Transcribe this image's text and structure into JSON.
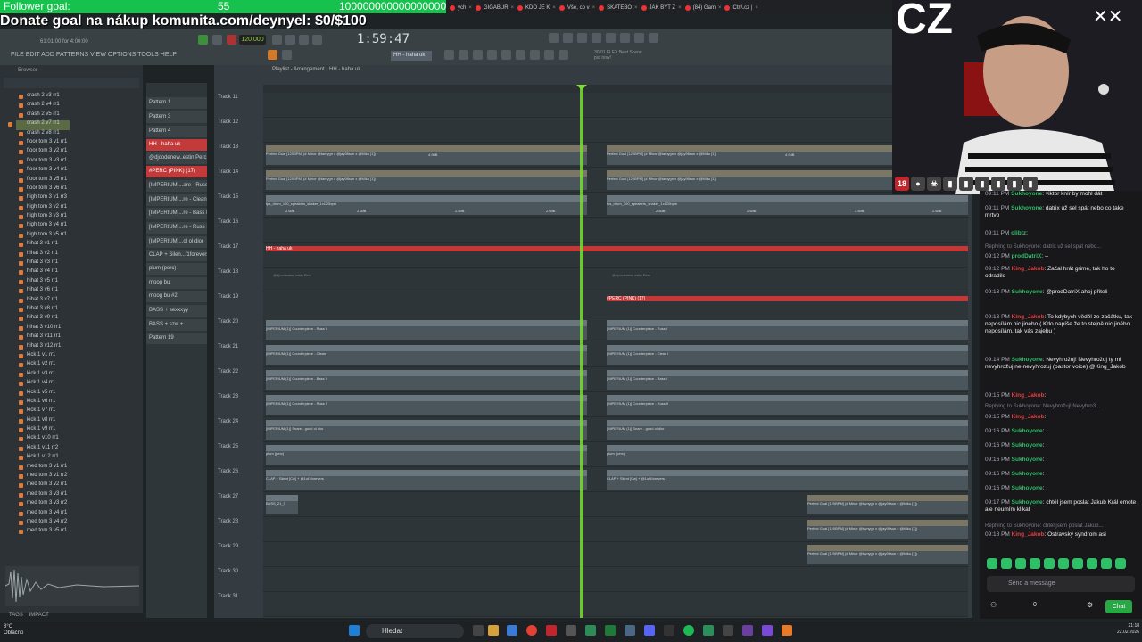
{
  "overlay": {
    "follower_label": "Follower goal:",
    "follower_count": "55",
    "follower_target": "1000000000000000000",
    "donate_text": "Donate goal na nákup komunita.com/deynyel: $0/$100",
    "cz_logo": "CZ"
  },
  "browser_tabs": [
    "ych",
    "GIGABUR",
    "KDO JE K",
    "Vše, co v",
    "SKATEBO",
    "JAK BÝT Z",
    "(84) Gam",
    "Ctrl\\.cz |"
  ],
  "fl": {
    "menu": "FILE EDIT ADD PATTERNS VIEW OPTIONS TOOLS HELP",
    "song_info": "61:01:00 for 4:00:00",
    "bpm": "120.000",
    "time": "1:59:47",
    "pattern_selector": "HH - haha uk",
    "hint_line1": "30:01 FLEX Beat Scene",
    "hint_line2": "put now!",
    "browser_title": "Browser",
    "playlist_title": "Playlist - Arrangement › HH - haha uk",
    "tags_label": "TAGS",
    "impact_label": "IMPACT"
  },
  "browser_items": [
    "crash 2 v3 rr1",
    "crash 2 v4 rr1",
    "crash 2 v5 rr1",
    "crash 2 v7 rr1",
    "crash 2 v8 rr1",
    "floor tom 3 v1 rr1",
    "floor tom 3 v2 rr1",
    "floor tom 3 v3 rr1",
    "floor tom 3 v4 rr1",
    "floor tom 3 v5 rr1",
    "floor tom 3 v6 rr1",
    "high tom 3 v1 rr3",
    "high tom 3 v2 rr1",
    "high tom 3 v3 rr1",
    "high tom 3 v4 rr1",
    "high tom 3 v5 rr1",
    "hihat 3 v1 rr1",
    "hihat 3 v2 rr1",
    "hihat 3 v3 rr1",
    "hihat 3 v4 rr1",
    "hihat 3 v5 rr1",
    "hihat 3 v6 rr1",
    "hihat 3 v7 rr1",
    "hihat 3 v8 rr1",
    "hihat 3 v9 rr1",
    "hihat 3 v10 rr1",
    "hihat 3 v11 rr1",
    "hihat 3 v12 rr1",
    "kick 1 v1 rr1",
    "kick 1 v2 rr1",
    "kick 1 v3 rr1",
    "kick 1 v4 rr1",
    "kick 1 v5 rr1",
    "kick 1 v6 rr1",
    "kick 1 v7 rr1",
    "kick 1 v8 rr1",
    "kick 1 v9 rr1",
    "kick 1 v10 rr1",
    "kick 1 v11 rr2",
    "kick 1 v12 rr1",
    "med tom 3 v1 rr1",
    "med tom 3 v1 rr2",
    "med tom 3 v2 rr1",
    "med tom 3 v3 rr1",
    "med tom 3 v3 rr2",
    "med tom 3 v4 rr1",
    "med tom 3 v4 rr2",
    "med tom 3 v5 rr1"
  ],
  "patterns": [
    "Pattern 1",
    "Pattern 3",
    "Pattern 4",
    "HH - haha uk",
    "@djcodenew..estin Perc",
    "#PERC (PINK) (17)",
    "[IMPERIUM]...are - Russ I",
    "[IMPERIUM]...re - Clean I",
    "[IMPERIUM]...re - Bass I",
    "[IMPERIUM]...re - Russ II",
    "[IMPERIUM]...ol ol dior",
    "CLAP + Silen...f1forevers",
    "plum (perc)",
    "moog bu",
    "moog bu #2",
    "BASS + sexxxyy",
    "BASS + szw +",
    "Pattern 19"
  ],
  "tracks": [
    "Track 11",
    "Track 12",
    "Track 13",
    "Track 14",
    "Track 15",
    "Track 16",
    "Track 17",
    "Track 18",
    "Track 19",
    "Track 20",
    "Track 21",
    "Track 22",
    "Track 23",
    "Track 24",
    "Track 25",
    "Track 26",
    "Track 27",
    "Track 28",
    "Track 29",
    "Track 30",
    "Track 31"
  ],
  "clips": {
    "perfect": "Perfect Goal [120BPM] (# Minor @tamygn x @jay98sun x @Miku [1])",
    "shaker": "fps_drum_100_speakers_shaker_1x120bpm",
    "hh": "HH - haha uk",
    "perc": "#PERC (PINK) (17)",
    "russ": "[IMPERIUM (1)] Counterpiece - Russ I",
    "clean": "[IMPERIUM (1)] Counterpiece - Clean I",
    "bass": "[IMPERIUM (1)] Counterpiece - Bass I",
    "russ2": "[IMPERIUM (1)] Counterpiece - Russ II",
    "snare": "[IMPERIUM (1)] Snare - good ol dior",
    "plum": "plum (perc)",
    "clap": "CLAP + Silent [Cw] + @1of1forevers",
    "bass2": "BASS_21_5",
    "db": "2.6dB",
    "db2": "4.9dB",
    "perc_ghost": "@djcodenew..estin Perc"
  },
  "chat": [
    {
      "time": "09:11 PM",
      "name": "Sukhoyone",
      "color": "g",
      "text": "viktor knír by mohl dát"
    },
    {
      "time": "09:11 PM",
      "name": "Sukhoyone",
      "color": "g",
      "text": "datrix už sel spát nebo co take mrtvo"
    },
    {
      "time": "09:11 PM",
      "name": "olibtz",
      "color": "g",
      "text": ""
    },
    {
      "time": "",
      "name": "",
      "color": "",
      "reply": "Replying to Sukhoyone: datrix už sel spát nebo..."
    },
    {
      "time": "09:12 PM",
      "name": "prodDatriX",
      "color": "g",
      "text": "--"
    },
    {
      "time": "09:12 PM",
      "name": "King_Jakob",
      "color": "r",
      "text": "Začal hrát grime, tak ho to odradilo"
    },
    {
      "time": "09:13 PM",
      "name": "Sukhoyone",
      "color": "g",
      "text": "@prodDatriX ahoj přiteli"
    },
    {
      "time": "09:13 PM",
      "name": "King_Jakob",
      "color": "r",
      "text": "To kdybych věděl ze začátku, tak neposílám nic jiného ( Kdo napíše že to stejně nic jiného neposílám, tak vás zajebu )"
    },
    {
      "time": "09:14 PM",
      "name": "Sukhoyone",
      "color": "g",
      "text": "Nevyhrožuj! Nevyhrožuj ty mi nevyhrožuj ne-nevyhrozuj (pastor voice) @King_Jakob"
    },
    {
      "time": "09:15 PM",
      "name": "King_Jakob",
      "color": "r",
      "text": ""
    },
    {
      "time": "",
      "name": "",
      "color": "",
      "reply": "Replying to Sukhoyone: Nevyhrožuj! Nevyhro3..."
    },
    {
      "time": "09:15 PM",
      "name": "King_Jakob",
      "color": "r",
      "text": ""
    },
    {
      "time": "09:16 PM",
      "name": "Sukhoyone",
      "color": "g",
      "text": ""
    },
    {
      "time": "09:16 PM",
      "name": "Sukhoyone",
      "color": "g",
      "text": ""
    },
    {
      "time": "09:16 PM",
      "name": "Sukhoyone",
      "color": "g",
      "text": ""
    },
    {
      "time": "09:16 PM",
      "name": "Sukhoyone",
      "color": "g",
      "text": ""
    },
    {
      "time": "09:16 PM",
      "name": "Sukhoyone",
      "color": "g",
      "text": ""
    },
    {
      "time": "09:17 PM",
      "name": "Sukhoyone",
      "color": "g",
      "text": "chtěl jsem poslat Jakub Král emote ale neumím klikat"
    },
    {
      "time": "",
      "name": "",
      "color": "",
      "reply": "Replying to Sukhoyone: chtěl jsem poslat Jakub..."
    },
    {
      "time": "09:18 PM",
      "name": "King_Jakob",
      "color": "r",
      "text": "Ostravský syndrom asi"
    }
  ],
  "chat_ui": {
    "input_placeholder": "Send a message",
    "chat_button": "Chat",
    "viewer_count": "0"
  },
  "taskbar": {
    "weather_temp": "8°C",
    "weather_desc": "Oblačno",
    "search_label": "Hledat",
    "time": "21:18",
    "date": "22.02.2026"
  },
  "badges": [
    "18",
    "●",
    "☣",
    "▮",
    "▮",
    "▮",
    "▮",
    "▮",
    "▮"
  ]
}
